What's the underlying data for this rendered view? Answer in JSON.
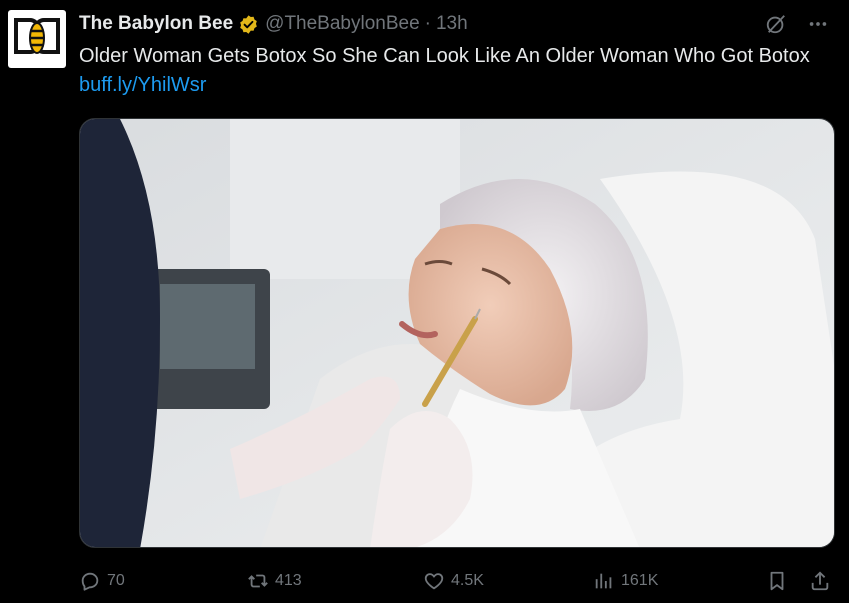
{
  "tweet": {
    "author_name": "The Babylon Bee",
    "handle": "@TheBabylonBee",
    "separator": "·",
    "time": "13h",
    "text": "Older Woman Gets Botox So She Can Look Like An Older Woman Who Got Botox ",
    "link": "buff.ly/YhilWsr"
  },
  "actions": {
    "replies": "70",
    "retweets": "413",
    "likes": "4.5K",
    "views": "161K"
  },
  "colors": {
    "background": "#000000",
    "text": "#e7e9ea",
    "muted": "#71767b",
    "link": "#1d9bf0",
    "verified_badge": "#e2b719"
  },
  "icons": [
    "babylon-bee-logo-icon",
    "verified-badge-icon",
    "grok-icon",
    "more-icon",
    "reply-icon",
    "retweet-icon",
    "like-icon",
    "views-icon",
    "bookmark-icon",
    "share-icon"
  ]
}
